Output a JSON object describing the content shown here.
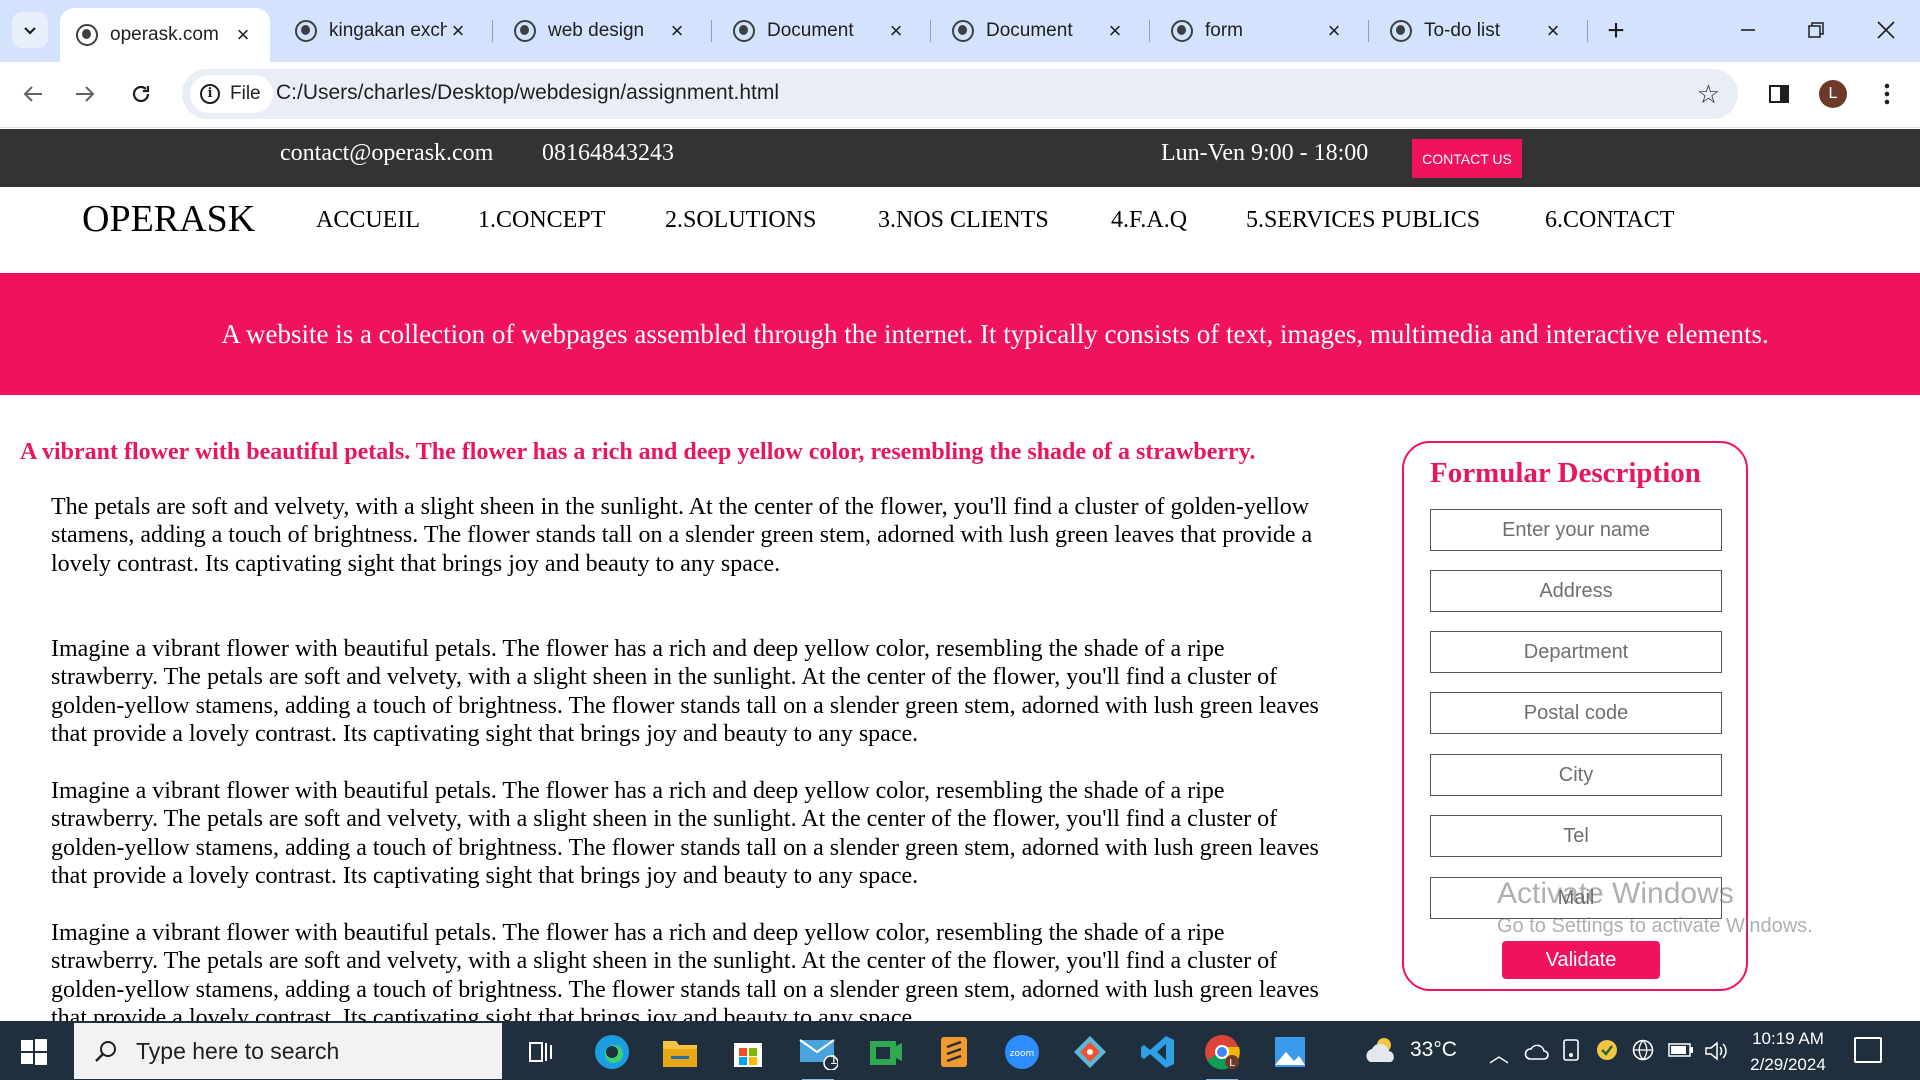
{
  "browser": {
    "tabs": [
      {
        "title": "operask.com",
        "active": true
      },
      {
        "title": "kingakan exch",
        "active": false
      },
      {
        "title": "web design",
        "active": false
      },
      {
        "title": "Document",
        "active": false
      },
      {
        "title": "Document",
        "active": false
      },
      {
        "title": "form",
        "active": false
      },
      {
        "title": "To-do list",
        "active": false
      }
    ],
    "chip_label": "File",
    "url": "C:/Users/charles/Desktop/webdesign/assignment.html",
    "profile_initial": "L"
  },
  "site": {
    "topbar": {
      "email": "contact@operask.com",
      "phone": "08164843243",
      "hours": "Lun-Ven 9:00 - 18:00",
      "contact_button": "CONTACT US"
    },
    "logo": "OPERASK",
    "nav": [
      "ACCUEIL",
      "1.CONCEPT",
      "2.SOLUTIONS",
      "3.NOS CLIENTS",
      "4.F.A.Q",
      "5.SERVICES PUBLICS",
      "6.CONTACT"
    ],
    "banner": "A website is a collection of webpages assembled through the internet. It typically consists of text, images, multimedia and interactive elements.",
    "headline": "A vibrant flower with beautiful petals. The flower has a rich and deep yellow color, resembling the shade of a strawberry.",
    "paragraphs": [
      "The petals are soft and velvety, with a slight sheen in the sunlight. At the center of the flower, you'll find a cluster of golden-yellow stamens, adding a touch of brightness. The flower stands tall on a slender green stem, adorned with lush green leaves that provide a lovely contrast. Its captivating sight that brings joy and beauty to any space.",
      "Imagine a vibrant flower with beautiful petals. The flower has a rich and deep yellow color, resembling the shade of a ripe strawberry. The petals are soft and velvety, with a slight sheen in the sunlight. At the center of the flower, you'll find a cluster of golden-yellow stamens, adding a touch of brightness. The flower stands tall on a slender green stem, adorned with lush green leaves that provide a lovely contrast. Its captivating sight that brings joy and beauty to any space.",
      "Imagine a vibrant flower with beautiful petals. The flower has a rich and deep yellow color, resembling the shade of a ripe strawberry. The petals are soft and velvety, with a slight sheen in the sunlight. At the center of the flower, you'll find a cluster of golden-yellow stamens, adding a touch of brightness. The flower stands tall on a slender green stem, adorned with lush green leaves that provide a lovely contrast. Its captivating sight that brings joy and beauty to any space.",
      "Imagine a vibrant flower with beautiful petals. The flower has a rich and deep yellow color, resembling the shade of a ripe strawberry. The petals are soft and velvety, with a slight sheen in the sunlight. At the center of the flower, you'll find a cluster of golden-yellow stamens, adding a touch of brightness. The flower stands tall on a slender green stem, adorned with lush green leaves that provide a lovely contrast. Its captivating sight that brings joy and beauty to any space."
    ],
    "form": {
      "title": "Formular Description",
      "placeholders": [
        "Enter your name",
        "Address",
        "Department",
        "Postal code",
        "City",
        "Tel",
        "Mail"
      ],
      "submit": "Validate"
    },
    "watermark": {
      "line1": "Activate Windows",
      "line2": "Go to Settings to activate Windows."
    }
  },
  "taskbar": {
    "search_placeholder": "Type here to search",
    "mail_badge": "1",
    "temperature": "33°C",
    "time": "10:19 AM",
    "date": "2/29/2024"
  },
  "colors": {
    "accent_pink": "#f0115f",
    "topbar_dark": "#333333",
    "tabstrip_blue": "#d3e3fd",
    "taskbar_dark": "#1f2f3d"
  },
  "icons": [
    "tab-search-icon",
    "globe-icon",
    "back-arrow-icon",
    "forward-arrow-icon",
    "reload-icon",
    "info-icon",
    "star-icon",
    "side-panel-icon",
    "kebab-menu-icon",
    "windows-start-icon",
    "search-icon",
    "task-view-icon",
    "edge-icon",
    "file-explorer-icon",
    "store-icon",
    "mail-icon",
    "chrome-icon",
    "vscode-icon",
    "zoom-icon",
    "weather-cloud-icon",
    "wifi-icon",
    "volume-icon",
    "notification-icon"
  ]
}
